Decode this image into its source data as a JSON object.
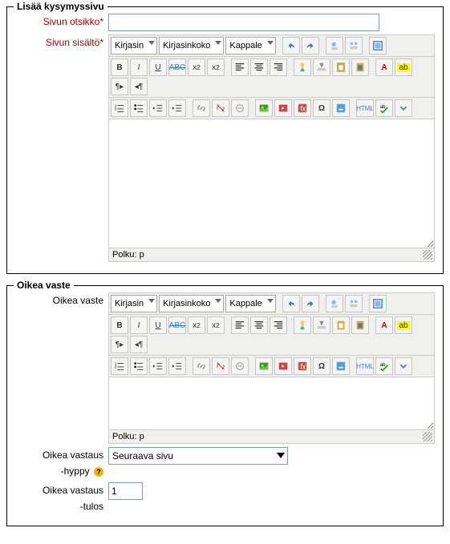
{
  "section1": {
    "legend": "Lisää kysymyssivu",
    "title_label": "Sivun otsikko",
    "content_label": "Sivun sisältö",
    "font_family": "Kirjasin",
    "font_size": "Kirjasinkoko",
    "paragraph": "Kappale",
    "path": "Polku: p"
  },
  "section2": {
    "legend": "Oikea vaste",
    "response_label": "Oikea vaste",
    "font_family": "Kirjasin",
    "font_size": "Kirjasinkoko",
    "paragraph": "Kappale",
    "path": "Polku: p",
    "jump_label1": "Oikea vastaus",
    "jump_label2": "-hyppy",
    "jump_value": "Seuraava sivu",
    "score_label1": "Oikea vastaus",
    "score_label2": "-tulos",
    "score_value": "1"
  },
  "req": "*"
}
